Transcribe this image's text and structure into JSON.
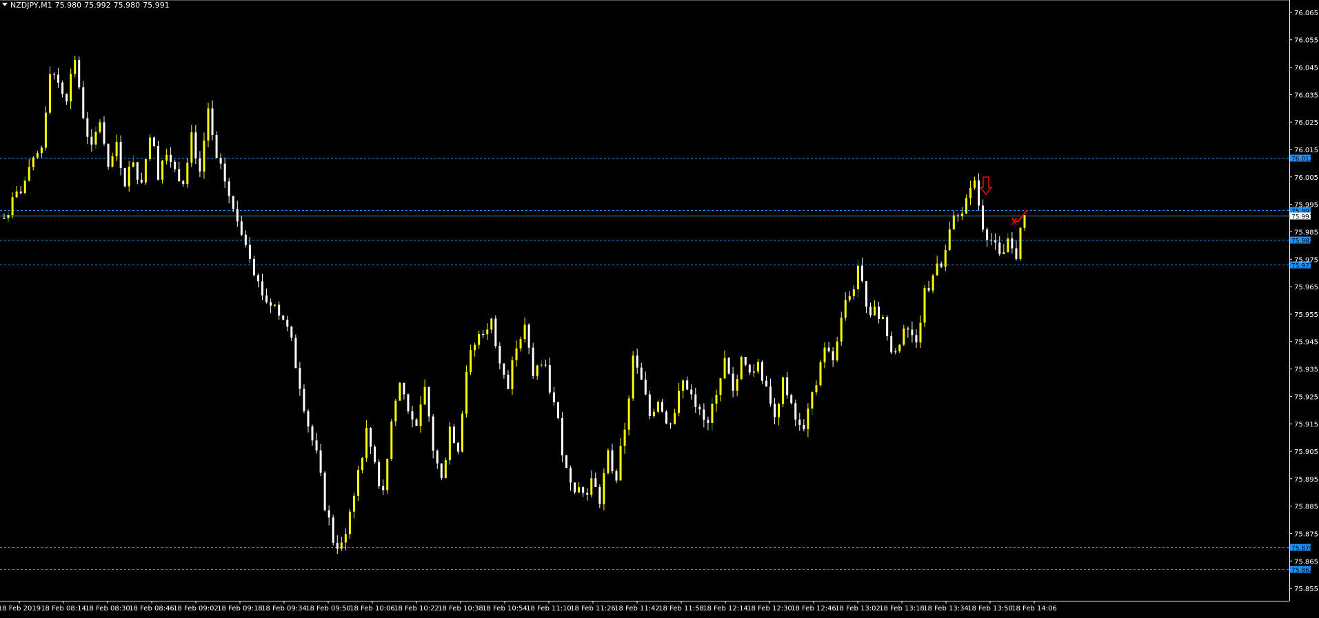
{
  "header": {
    "symbol": "NZDJPY,M1",
    "open": "75.980",
    "high": "75.992",
    "low": "75.980",
    "close": "75.991"
  },
  "chart_data": {
    "type": "candlestick",
    "symbol": "NZDJPY",
    "timeframe": "M1",
    "ylim": [
      75.8505,
      76.0695
    ],
    "price_ticks": [
      "76.065",
      "76.055",
      "76.045",
      "76.035",
      "76.025",
      "76.015",
      "76.005",
      "75.995",
      "75.985",
      "75.975",
      "75.965",
      "75.955",
      "75.945",
      "75.935",
      "75.925",
      "75.915",
      "75.905",
      "75.895",
      "75.885",
      "75.875",
      "75.865",
      "75.855"
    ],
    "time_labels": [
      "18 Feb 2019",
      "18 Feb 08:14",
      "18 Feb 08:30",
      "18 Feb 08:46",
      "18 Feb 09:02",
      "18 Feb 09:18",
      "18 Feb 09:34",
      "18 Feb 09:50",
      "18 Feb 10:06",
      "18 Feb 10:22",
      "18 Feb 10:38",
      "18 Feb 10:54",
      "18 Feb 11:10",
      "18 Feb 11:26",
      "18 Feb 11:42",
      "18 Feb 11:58",
      "18 Feb 12:14",
      "18 Feb 12:30",
      "18 Feb 12:46",
      "18 Feb 13:02",
      "18 Feb 13:18",
      "18 Feb 13:34",
      "18 Feb 13:50",
      "18 Feb 14:06"
    ],
    "levels": [
      {
        "price": 76.012,
        "label": "76.012",
        "style": "dashed"
      },
      {
        "price": 75.993,
        "label": "75.993",
        "style": "dashed"
      },
      {
        "price": 75.982,
        "label": "75.982",
        "style": "dashed"
      },
      {
        "price": 75.973,
        "label": "75.973",
        "style": "dashed"
      },
      {
        "price": 75.87,
        "label": "75.870",
        "style": "dashed"
      },
      {
        "price": 75.862,
        "label": "75.862",
        "style": "dashed"
      }
    ],
    "bid_line": {
      "price": 75.991,
      "label": "75.991"
    },
    "colors": {
      "background": "#000000",
      "bull": "#ffff00",
      "bear": "#ffffff",
      "bull_wick": "#00aa00",
      "level_line": "#1e90ff",
      "level_label_bg": "#1e90ff",
      "bid_line": "#5f9ea0",
      "markers": "#ff0000"
    },
    "close_path": [
      [
        0,
        75.99
      ],
      [
        3,
        75.998
      ],
      [
        6,
        76.006
      ],
      [
        9,
        76.016
      ],
      [
        11,
        76.045
      ],
      [
        13,
        76.04
      ],
      [
        15,
        76.035
      ],
      [
        17,
        76.048
      ],
      [
        19,
        76.028
      ],
      [
        21,
        76.014
      ],
      [
        23,
        76.026
      ],
      [
        25,
        76.006
      ],
      [
        27,
        76.018
      ],
      [
        29,
        76.003
      ],
      [
        31,
        76.012
      ],
      [
        33,
        76.001
      ],
      [
        35,
        76.022
      ],
      [
        37,
        76.007
      ],
      [
        39,
        76.016
      ],
      [
        41,
        76.007
      ],
      [
        43,
        76.005
      ],
      [
        45,
        76.021
      ],
      [
        47,
        76.007
      ],
      [
        49,
        76.03
      ],
      [
        51,
        76.01
      ],
      [
        53,
        76.004
      ],
      [
        55,
        75.992
      ],
      [
        57,
        75.986
      ],
      [
        59,
        75.978
      ],
      [
        61,
        75.966
      ],
      [
        63,
        75.96
      ],
      [
        65,
        75.958
      ],
      [
        67,
        75.954
      ],
      [
        69,
        75.944
      ],
      [
        71,
        75.93
      ],
      [
        73,
        75.915
      ],
      [
        75,
        75.903
      ],
      [
        77,
        75.886
      ],
      [
        79,
        75.873
      ],
      [
        81,
        75.87
      ],
      [
        83,
        75.884
      ],
      [
        85,
        75.898
      ],
      [
        87,
        75.912
      ],
      [
        89,
        75.902
      ],
      [
        91,
        75.888
      ],
      [
        93,
        75.916
      ],
      [
        95,
        75.93
      ],
      [
        97,
        75.922
      ],
      [
        99,
        75.912
      ],
      [
        101,
        75.928
      ],
      [
        103,
        75.906
      ],
      [
        105,
        75.894
      ],
      [
        107,
        75.914
      ],
      [
        109,
        75.907
      ],
      [
        111,
        75.935
      ],
      [
        113,
        75.944
      ],
      [
        115,
        75.95
      ],
      [
        117,
        75.952
      ],
      [
        119,
        75.94
      ],
      [
        121,
        75.928
      ],
      [
        123,
        75.945
      ],
      [
        125,
        75.95
      ],
      [
        127,
        75.932
      ],
      [
        129,
        75.939
      ],
      [
        131,
        75.928
      ],
      [
        133,
        75.915
      ],
      [
        135,
        75.898
      ],
      [
        137,
        75.893
      ],
      [
        139,
        75.89
      ],
      [
        141,
        75.894
      ],
      [
        143,
        75.888
      ],
      [
        145,
        75.903
      ],
      [
        147,
        75.895
      ],
      [
        149,
        75.914
      ],
      [
        151,
        75.938
      ],
      [
        153,
        75.93
      ],
      [
        155,
        75.918
      ],
      [
        157,
        75.925
      ],
      [
        159,
        75.914
      ],
      [
        161,
        75.92
      ],
      [
        163,
        75.93
      ],
      [
        165,
        75.928
      ],
      [
        167,
        75.918
      ],
      [
        169,
        75.914
      ],
      [
        171,
        75.928
      ],
      [
        173,
        75.938
      ],
      [
        175,
        75.925
      ],
      [
        177,
        75.938
      ],
      [
        179,
        75.933
      ],
      [
        181,
        75.936
      ],
      [
        183,
        75.93
      ],
      [
        185,
        75.918
      ],
      [
        187,
        75.93
      ],
      [
        189,
        75.92
      ],
      [
        191,
        75.913
      ],
      [
        193,
        75.918
      ],
      [
        195,
        75.93
      ],
      [
        197,
        75.944
      ],
      [
        199,
        75.936
      ],
      [
        201,
        75.955
      ],
      [
        203,
        75.962
      ],
      [
        205,
        75.97
      ],
      [
        207,
        75.96
      ],
      [
        209,
        75.955
      ],
      [
        211,
        75.954
      ],
      [
        213,
        75.94
      ],
      [
        215,
        75.946
      ],
      [
        217,
        75.948
      ],
      [
        219,
        75.947
      ],
      [
        221,
        75.962
      ],
      [
        223,
        75.97
      ],
      [
        225,
        75.972
      ],
      [
        227,
        75.985
      ],
      [
        229,
        75.993
      ],
      [
        231,
        75.995
      ],
      [
        233,
        76.002
      ],
      [
        235,
        75.988
      ],
      [
        237,
        75.982
      ],
      [
        239,
        75.975
      ],
      [
        241,
        75.98
      ],
      [
        243,
        75.977
      ],
      [
        245,
        75.991
      ]
    ]
  }
}
